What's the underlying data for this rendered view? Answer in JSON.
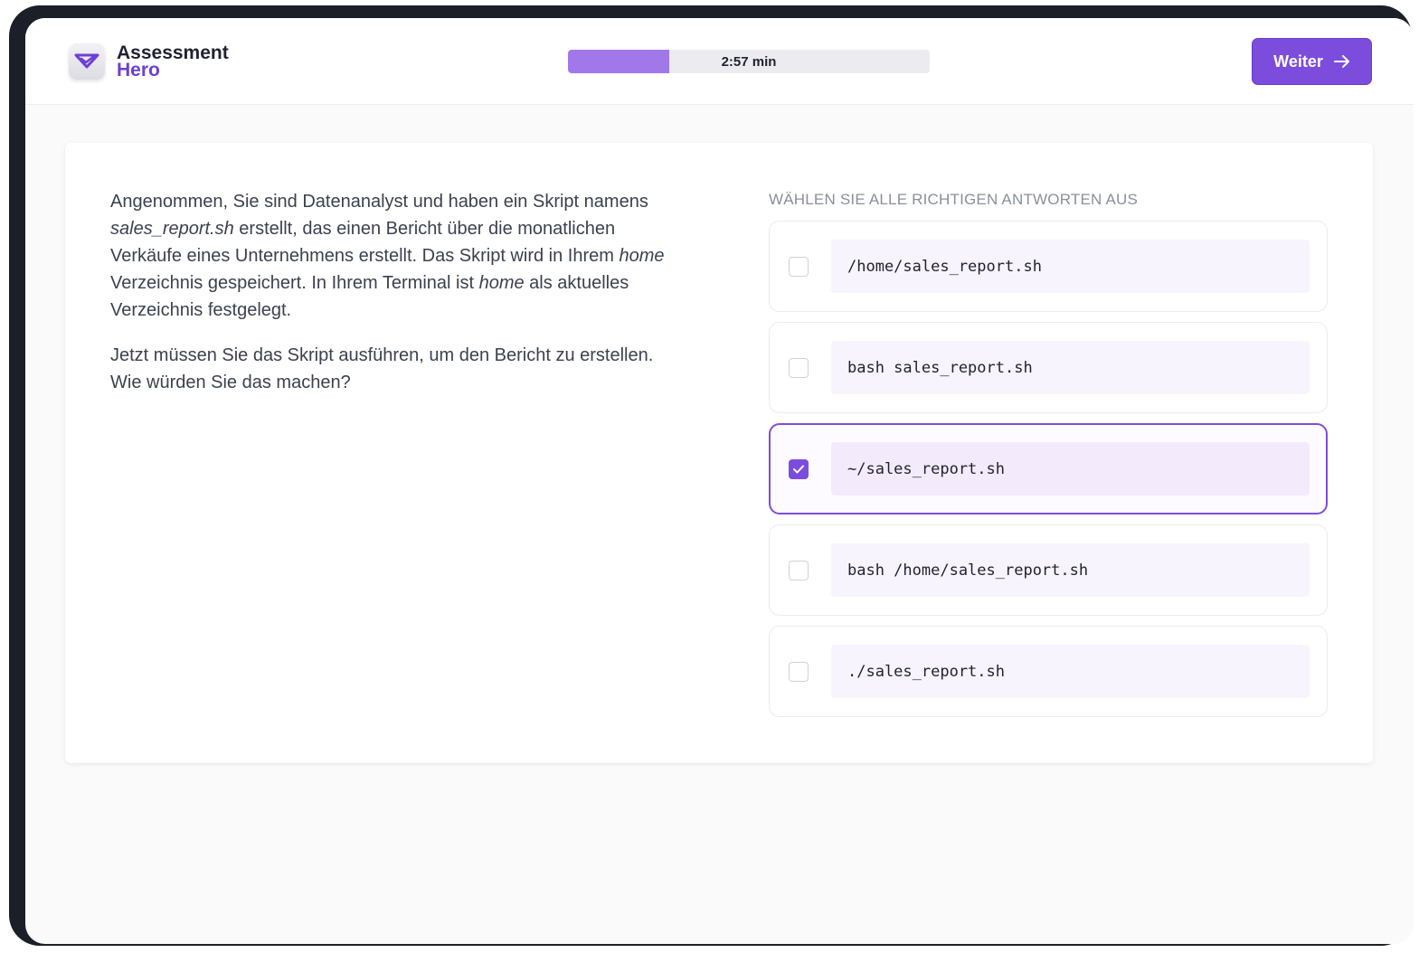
{
  "brand": {
    "line1": "Assessment",
    "line2": "Hero",
    "color": "#6d3fd6"
  },
  "timer": {
    "label": "2:57 min",
    "progress": 0.28
  },
  "header": {
    "next_label": "Weiter"
  },
  "question": {
    "p1_a": "Angenommen, Sie sind Datenanalyst und haben ein Skript namens ",
    "p1_file": "sales_report.sh",
    "p1_b": " erstellt, das einen Bericht über die monatlichen Verkäufe eines Unternehmens erstellt. Das Skript wird in Ihrem ",
    "p1_home1": "home",
    "p1_c": " Verzeichnis gespeichert. In Ihrem Terminal ist ",
    "p1_home2": "home",
    "p1_d": " als aktuelles Verzeichnis festgelegt.",
    "p2": "Jetzt müssen Sie das Skript ausführen, um den Bericht zu erstellen. Wie würden Sie das machen?"
  },
  "answers": {
    "instruction": "WÄHLEN SIE ALLE RICHTIGEN ANTWORTEN AUS",
    "options": [
      {
        "text": "/home/sales_report.sh",
        "checked": false
      },
      {
        "text": "bash sales_report.sh",
        "checked": false
      },
      {
        "text": "~/sales_report.sh",
        "checked": true
      },
      {
        "text": "bash /home/sales_report.sh",
        "checked": false
      },
      {
        "text": "./sales_report.sh",
        "checked": false
      }
    ]
  },
  "colors": {
    "accent": "#7c4ddc",
    "timer_fill": "#a078ea"
  }
}
